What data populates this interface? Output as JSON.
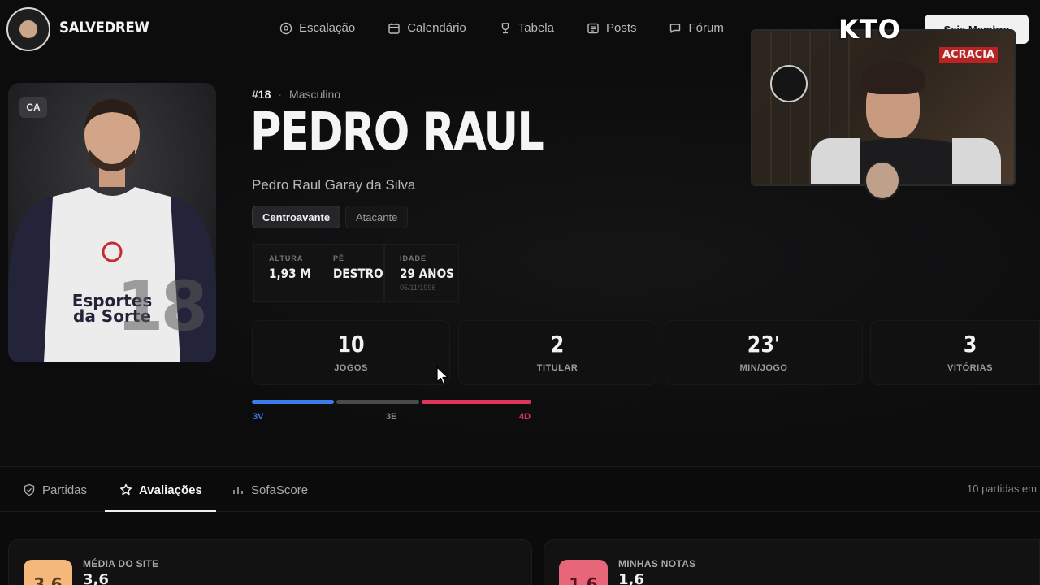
{
  "app": {
    "brand": "SALVEDREW",
    "signup_label": "Seja Membro"
  },
  "nav": [
    {
      "label": "Escalação",
      "icon": "soccer-ball-icon"
    },
    {
      "label": "Calendário",
      "icon": "calendar-icon"
    },
    {
      "label": "Tabela",
      "icon": "trophy-icon"
    },
    {
      "label": "Posts",
      "icon": "newspaper-icon"
    },
    {
      "label": "Fórum",
      "icon": "chat-icon"
    }
  ],
  "player": {
    "position_badge": "CA",
    "shirt_number": "18",
    "number_label": "#18",
    "gender": "Masculino",
    "name": "PEDRO RAUL",
    "full_name": "Pedro Raul Garay da Silva",
    "positions": [
      "Centroavante",
      "Atacante"
    ],
    "attributes": [
      {
        "label": "ALTURA",
        "value": "1,93 M",
        "sub": ""
      },
      {
        "label": "PÉ",
        "value": "DESTRO",
        "sub": ""
      },
      {
        "label": "IDADE",
        "value": "29 ANOS",
        "sub": "05/11/1996"
      }
    ]
  },
  "stats": [
    {
      "value": "10",
      "label": "JOGOS"
    },
    {
      "value": "2",
      "label": "TITULAR"
    },
    {
      "value": "23'",
      "label": "MIN/JOGO"
    },
    {
      "value": "3",
      "label": "VITÓRIAS"
    }
  ],
  "record": {
    "wins_label": "3V",
    "draws_label": "3E",
    "losses_label": "4D",
    "wins": 3,
    "draws": 3,
    "losses": 4,
    "colors": {
      "wins": "#3b7bea",
      "draws": "#4a4a4d",
      "losses": "#e0355a"
    }
  },
  "tabs": [
    {
      "label": "Partidas",
      "icon": "shield-icon",
      "active": false
    },
    {
      "label": "Avaliações",
      "icon": "star-icon",
      "active": true
    },
    {
      "label": "SofaScore",
      "icon": "bar-chart-icon",
      "active": false
    }
  ],
  "tabs_right_text": "10 partidas em",
  "ratings": [
    {
      "title": "MÉDIA DO SITE",
      "value": "3,6",
      "badge": "3,6",
      "color": "#f4b87a"
    },
    {
      "title": "MINHAS NOTAS",
      "value": "1,6",
      "badge": "1,6",
      "color": "#e8667a"
    }
  ],
  "overlay": {
    "sponsor": "KTO",
    "sign_text": "ACRACIA"
  },
  "colors": {
    "accent_blue": "#3b7bea",
    "accent_red": "#e0355a",
    "background": "#0b0b0c"
  }
}
